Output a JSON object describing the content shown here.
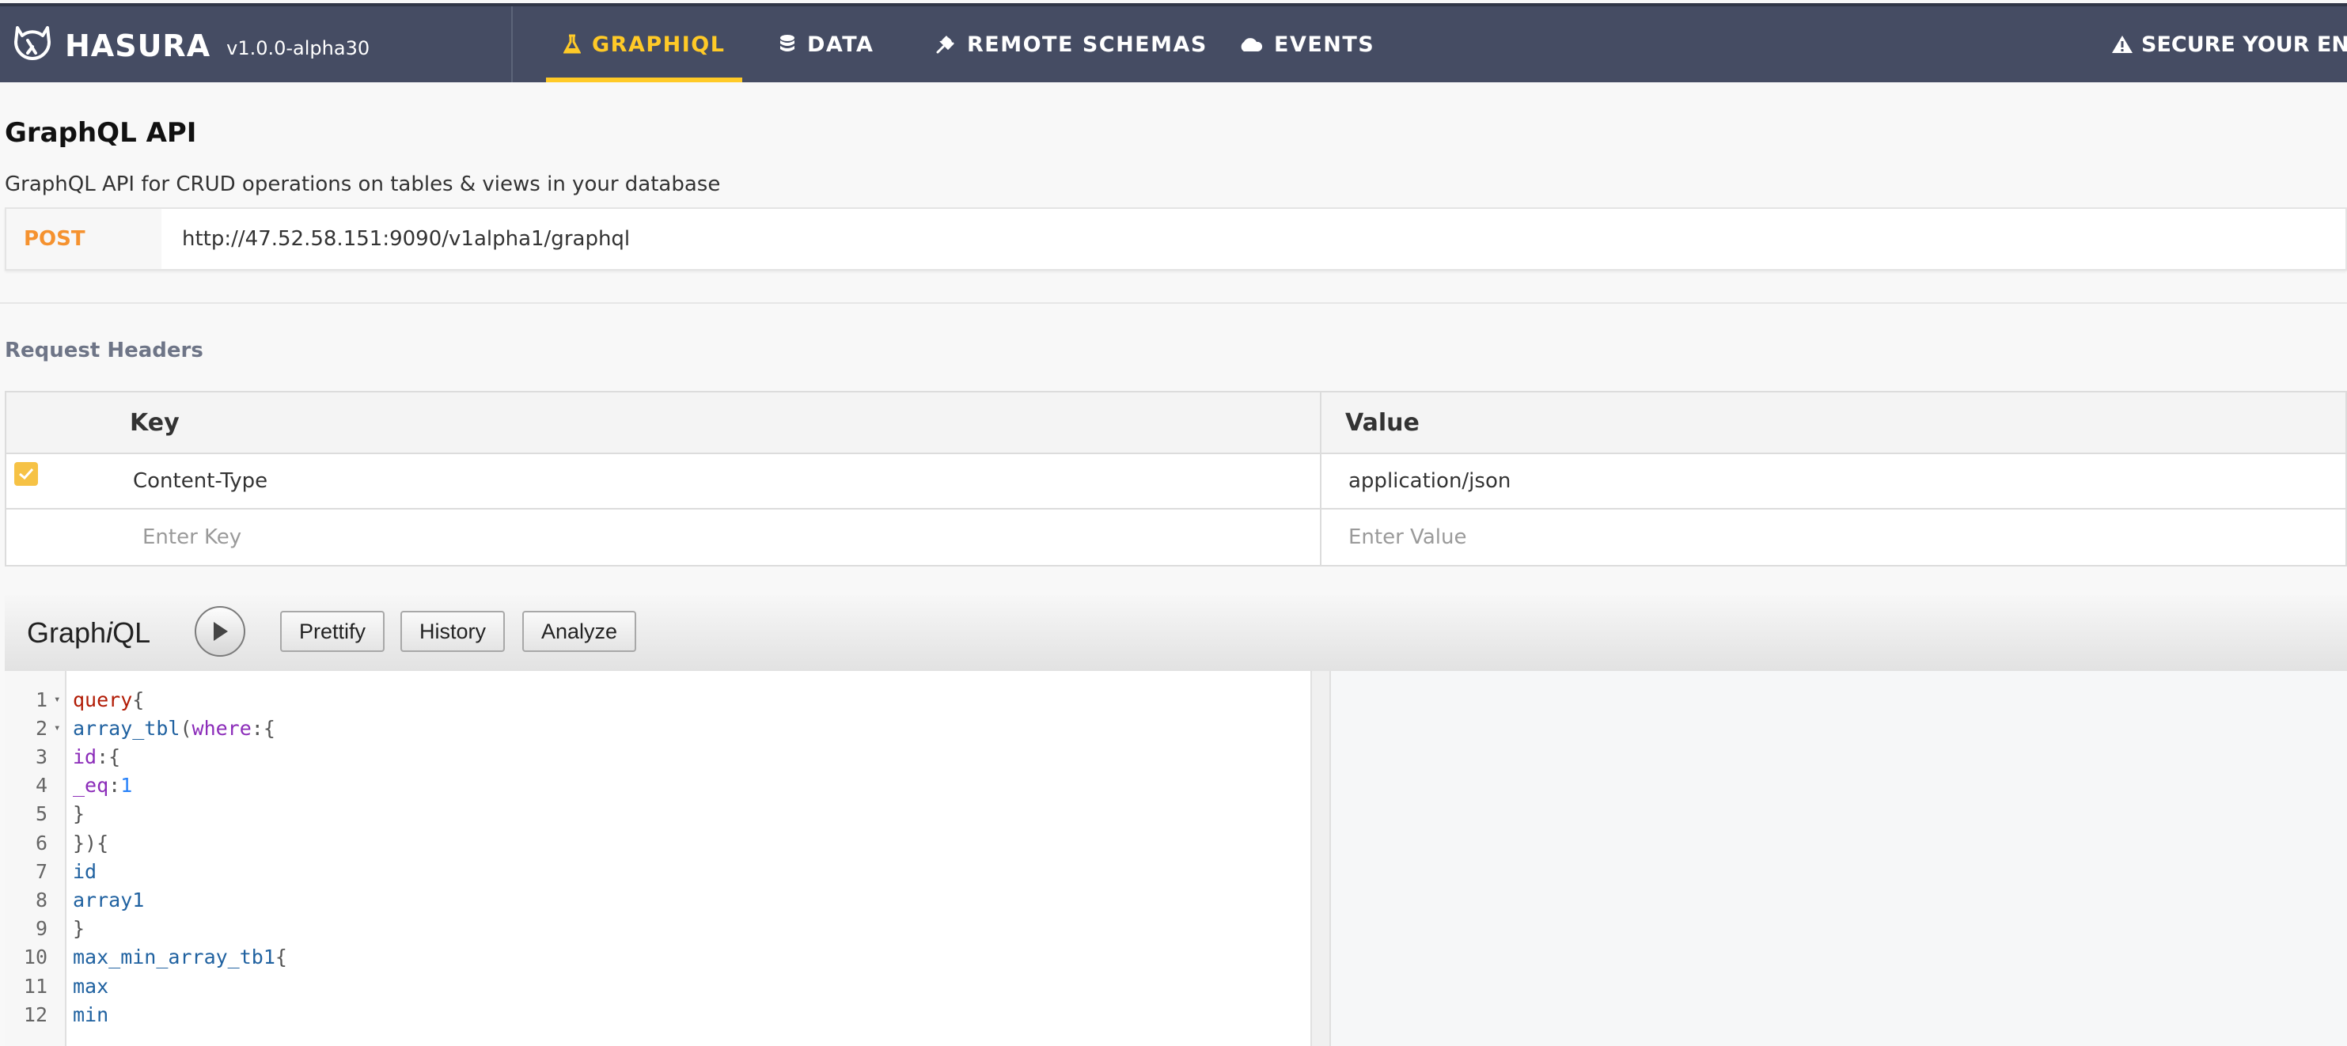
{
  "brand": {
    "name": "HASURA",
    "version": "v1.0.0-alpha30"
  },
  "nav": {
    "tabs": [
      {
        "label": "GRAPHIQL",
        "icon": "flask-icon",
        "active": true
      },
      {
        "label": "DATA",
        "icon": "database-icon",
        "active": false
      },
      {
        "label": "REMOTE SCHEMAS",
        "icon": "plug-icon",
        "active": false
      },
      {
        "label": "EVENTS",
        "icon": "cloud-icon",
        "active": false
      }
    ],
    "secure_label": "SECURE YOUR ENDPO"
  },
  "api": {
    "title": "GraphQL API",
    "subtitle": "GraphQL API for CRUD operations on tables & views in your database",
    "method": "POST",
    "url": "http://47.52.58.151:9090/v1alpha1/graphql"
  },
  "headers": {
    "label": "Request Headers",
    "key_col": "Key",
    "value_col": "Value",
    "rows": [
      {
        "key": "Content-Type",
        "value": "application/json",
        "checked": true
      }
    ],
    "key_placeholder": "Enter Key",
    "value_placeholder": "Enter Value"
  },
  "graphiql": {
    "title_pre": "Graph",
    "title_i": "i",
    "title_post": "QL",
    "buttons": {
      "prettify": "Prettify",
      "history": "History",
      "analyze": "Analyze"
    },
    "code_lines": [
      "query {",
      "  array_tbl(where:{",
      "    id:{",
      "      _eq:1",
      "    }",
      "  }) {",
      "    id",
      "    array1",
      "  }",
      "  max_min_array_tb1 {",
      "    max",
      "    min"
    ]
  },
  "colors": {
    "nav_bg": "#454c63",
    "accent": "#ffca27",
    "method": "#f5922f"
  }
}
